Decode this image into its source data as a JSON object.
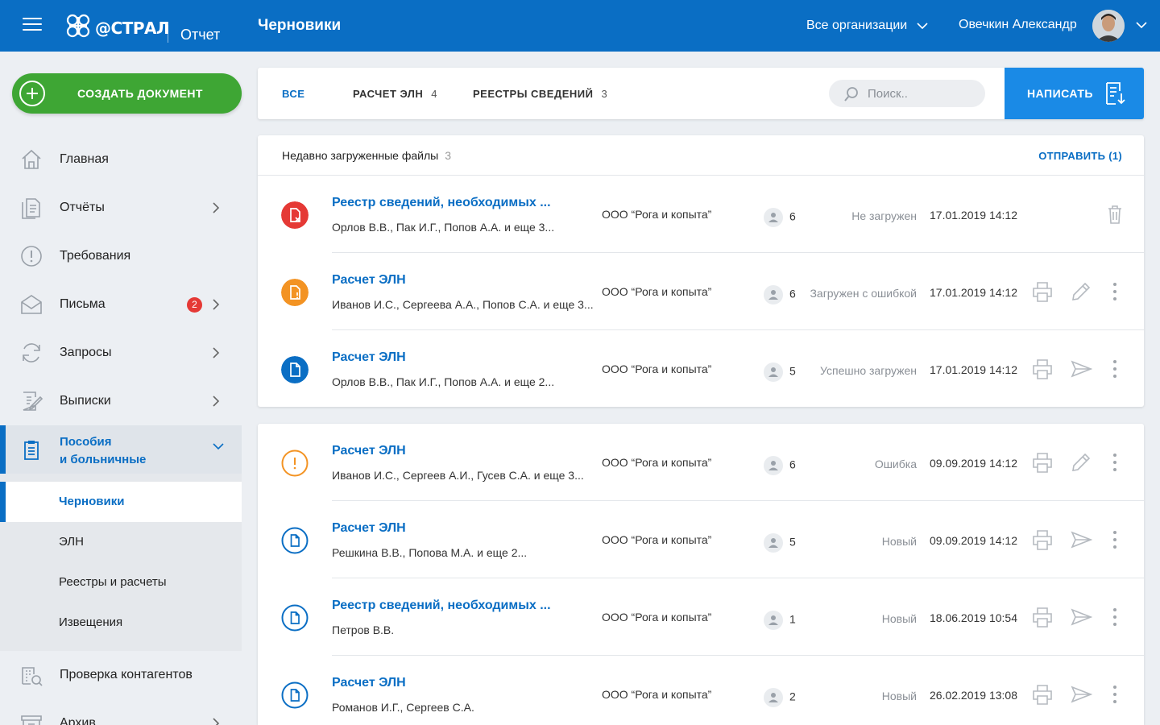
{
  "header": {
    "logo_text": "@СТРАЛ",
    "product": "Отчет",
    "title": "Черновики",
    "org_selector": "Все организации",
    "user_name": "Овечкин Александр"
  },
  "sidebar": {
    "create_label": "СОЗДАТЬ ДОКУМЕНТ",
    "items": [
      {
        "label": "Главная",
        "icon": "home-icon"
      },
      {
        "label": "Отчёты",
        "icon": "reports-icon"
      },
      {
        "label": "Требования",
        "icon": "warning-icon"
      },
      {
        "label": "Письма",
        "icon": "mail-icon",
        "badge": "2"
      },
      {
        "label": "Запросы",
        "icon": "refresh-icon"
      },
      {
        "label": "Выписки",
        "icon": "edit-doc-icon"
      }
    ],
    "active_section": {
      "line1": "Пособия",
      "line2": "и больничные"
    },
    "sub_items": [
      "Черновики",
      "ЭЛН",
      "Реестры и расчеты",
      "Извещения"
    ],
    "lower_items": [
      {
        "label": "Проверка контагентов",
        "icon": "check-company-icon"
      },
      {
        "label": "Архив",
        "icon": "archive-icon"
      }
    ]
  },
  "toolbar": {
    "tabs": [
      {
        "label": "ВСЕ",
        "count": ""
      },
      {
        "label": "РАСЧЕТ ЭЛН",
        "count": "4"
      },
      {
        "label": "РЕЕСТРЫ СВЕДЕНИЙ",
        "count": "3"
      }
    ],
    "search_placeholder": "Поиск..",
    "write_label": "НАПИСАТЬ"
  },
  "recent": {
    "title": "Недавно загруженные файлы",
    "count": "3",
    "send_label": "ОТПРАВИТЬ (1)",
    "rows": [
      {
        "title": "Реестр сведений, необходимых ...",
        "persons": "Орлов В.В., Пак И.Г., Попов А.А. и еще 3...",
        "org": "ООО “Рога и копыта”",
        "count": "6",
        "state": "Не загружен",
        "date": "17.01.2019 14:12",
        "status_color": "#e53935"
      },
      {
        "title": "Расчет ЭЛН",
        "persons": "Иванов И.С., Сергеева А.А., Попов С.А. и еще 3...",
        "org": "ООО “Рога и копыта”",
        "count": "6",
        "state": "Загружен с ошибкой",
        "date": "17.01.2019 14:12",
        "status_color": "#f39323"
      },
      {
        "title": "Расчет ЭЛН",
        "persons": "Орлов В.В., Пак И.Г., Попов А.А. и еще 2...",
        "org": "ООО “Рога и копыта”",
        "count": "5",
        "state": "Успешно загружен",
        "date": "17.01.2019 14:12",
        "status_color": "#0a6ec4"
      }
    ]
  },
  "drafts": {
    "rows": [
      {
        "title": "Расчет ЭЛН",
        "persons": "Иванов И.С., Сергеев А.И., Гусев С.А. и еще 3...",
        "org": "ООО “Рога и копыта”",
        "count": "6",
        "state": "Ошибка",
        "date": "09.09.2019 14:12"
      },
      {
        "title": "Расчет ЭЛН",
        "persons": "Решкина В.В., Попова М.А. и еще 2...",
        "org": "ООО “Рога и копыта”",
        "count": "5",
        "state": "Новый",
        "date": "09.09.2019 14:12"
      },
      {
        "title": "Реестр сведений, необходимых ...",
        "persons": "Петров В.В.",
        "org": "ООО “Рога и копыта”",
        "count": "1",
        "state": "Новый",
        "date": "18.06.2019 10:54"
      },
      {
        "title": "Расчет ЭЛН",
        "persons": "Романов И.Г., Сергеев С.А.",
        "org": "ООО “Рога и копыта”",
        "count": "2",
        "state": "Новый",
        "date": "26.02.2019 13:08"
      }
    ]
  },
  "colors": {
    "brand": "#0a6ec4",
    "create": "#3ea634",
    "error": "#e53935",
    "warning": "#f39323"
  }
}
